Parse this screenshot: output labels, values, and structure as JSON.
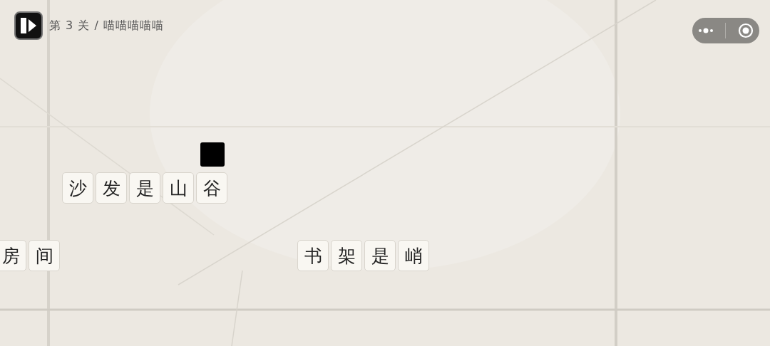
{
  "header": {
    "title": "第 3 关 / 喵喵喵喵喵"
  },
  "word_groups": [
    {
      "tiles": [
        "沙",
        "发",
        "是",
        "山",
        "谷"
      ]
    },
    {
      "tiles": [
        "房",
        "间"
      ]
    },
    {
      "tiles": [
        "书",
        "架",
        "是",
        "峭"
      ]
    }
  ]
}
